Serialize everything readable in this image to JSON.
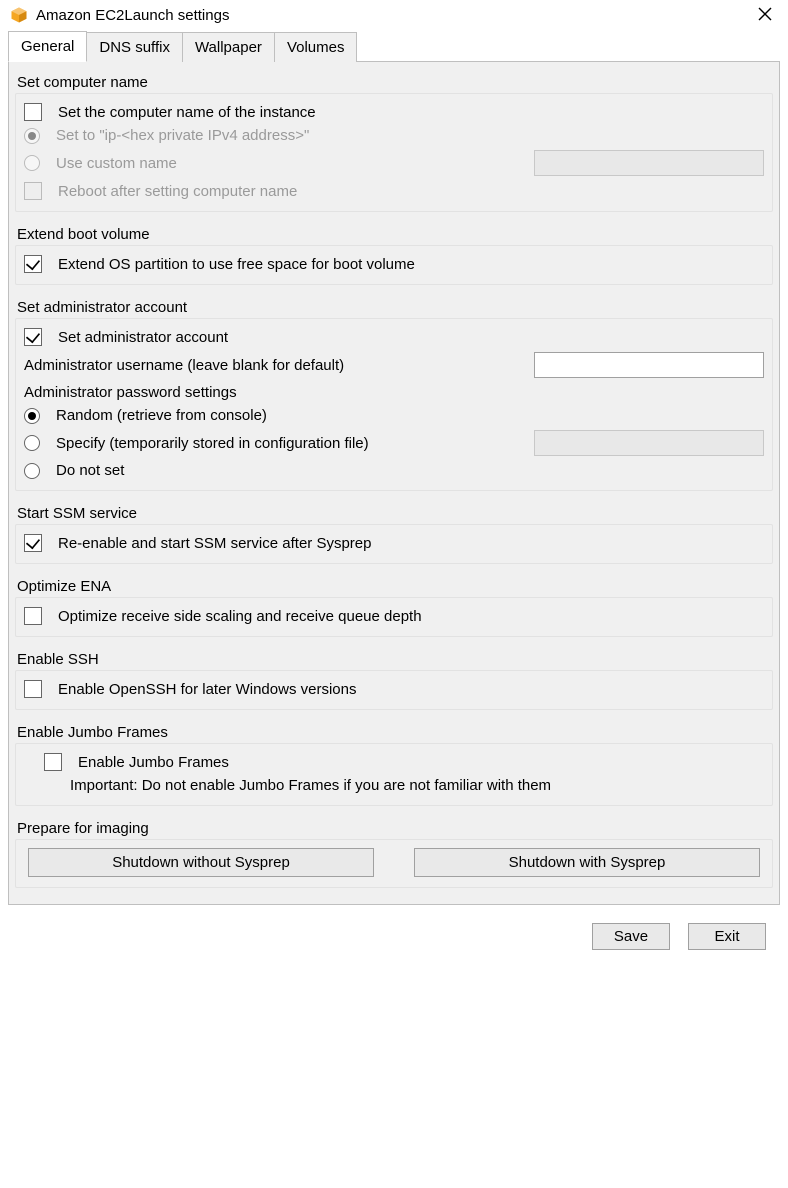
{
  "window": {
    "title": "Amazon EC2Launch settings"
  },
  "tabs": {
    "general": "General",
    "dns": "DNS suffix",
    "wallpaper": "Wallpaper",
    "volumes": "Volumes"
  },
  "groups": {
    "computer_name": {
      "title": "Set computer name",
      "set_name_cb": "Set the computer name of the instance",
      "set_to_ip": "Set to \"ip-<hex private IPv4 address>\"",
      "use_custom": "Use custom name",
      "custom_value": "",
      "reboot_cb": "Reboot after setting computer name"
    },
    "extend_boot": {
      "title": "Extend boot volume",
      "extend_cb": "Extend OS partition to use free space for boot volume"
    },
    "admin_account": {
      "title": "Set administrator account",
      "set_cb": "Set administrator account",
      "username_label": "Administrator username (leave blank for default)",
      "username_value": "",
      "password_label": "Administrator password settings",
      "pw_random": "Random (retrieve from console)",
      "pw_specify": "Specify (temporarily stored in configuration file)",
      "pw_specify_value": "",
      "pw_none": "Do not set"
    },
    "ssm": {
      "title": "Start SSM service",
      "cb": "Re-enable and start SSM service after Sysprep"
    },
    "ena": {
      "title": "Optimize ENA",
      "cb": "Optimize receive side scaling and receive queue depth"
    },
    "ssh": {
      "title": "Enable SSH",
      "cb": "Enable OpenSSH for later Windows versions"
    },
    "jumbo": {
      "title": "Enable Jumbo Frames",
      "cb": "Enable Jumbo Frames",
      "note": "Important: Do not enable Jumbo Frames if you are not familiar with them"
    },
    "prepare": {
      "title": "Prepare for imaging",
      "shutdown_no_sysprep": "Shutdown without Sysprep",
      "shutdown_sysprep": "Shutdown with Sysprep"
    }
  },
  "footer": {
    "save": "Save",
    "exit": "Exit"
  }
}
